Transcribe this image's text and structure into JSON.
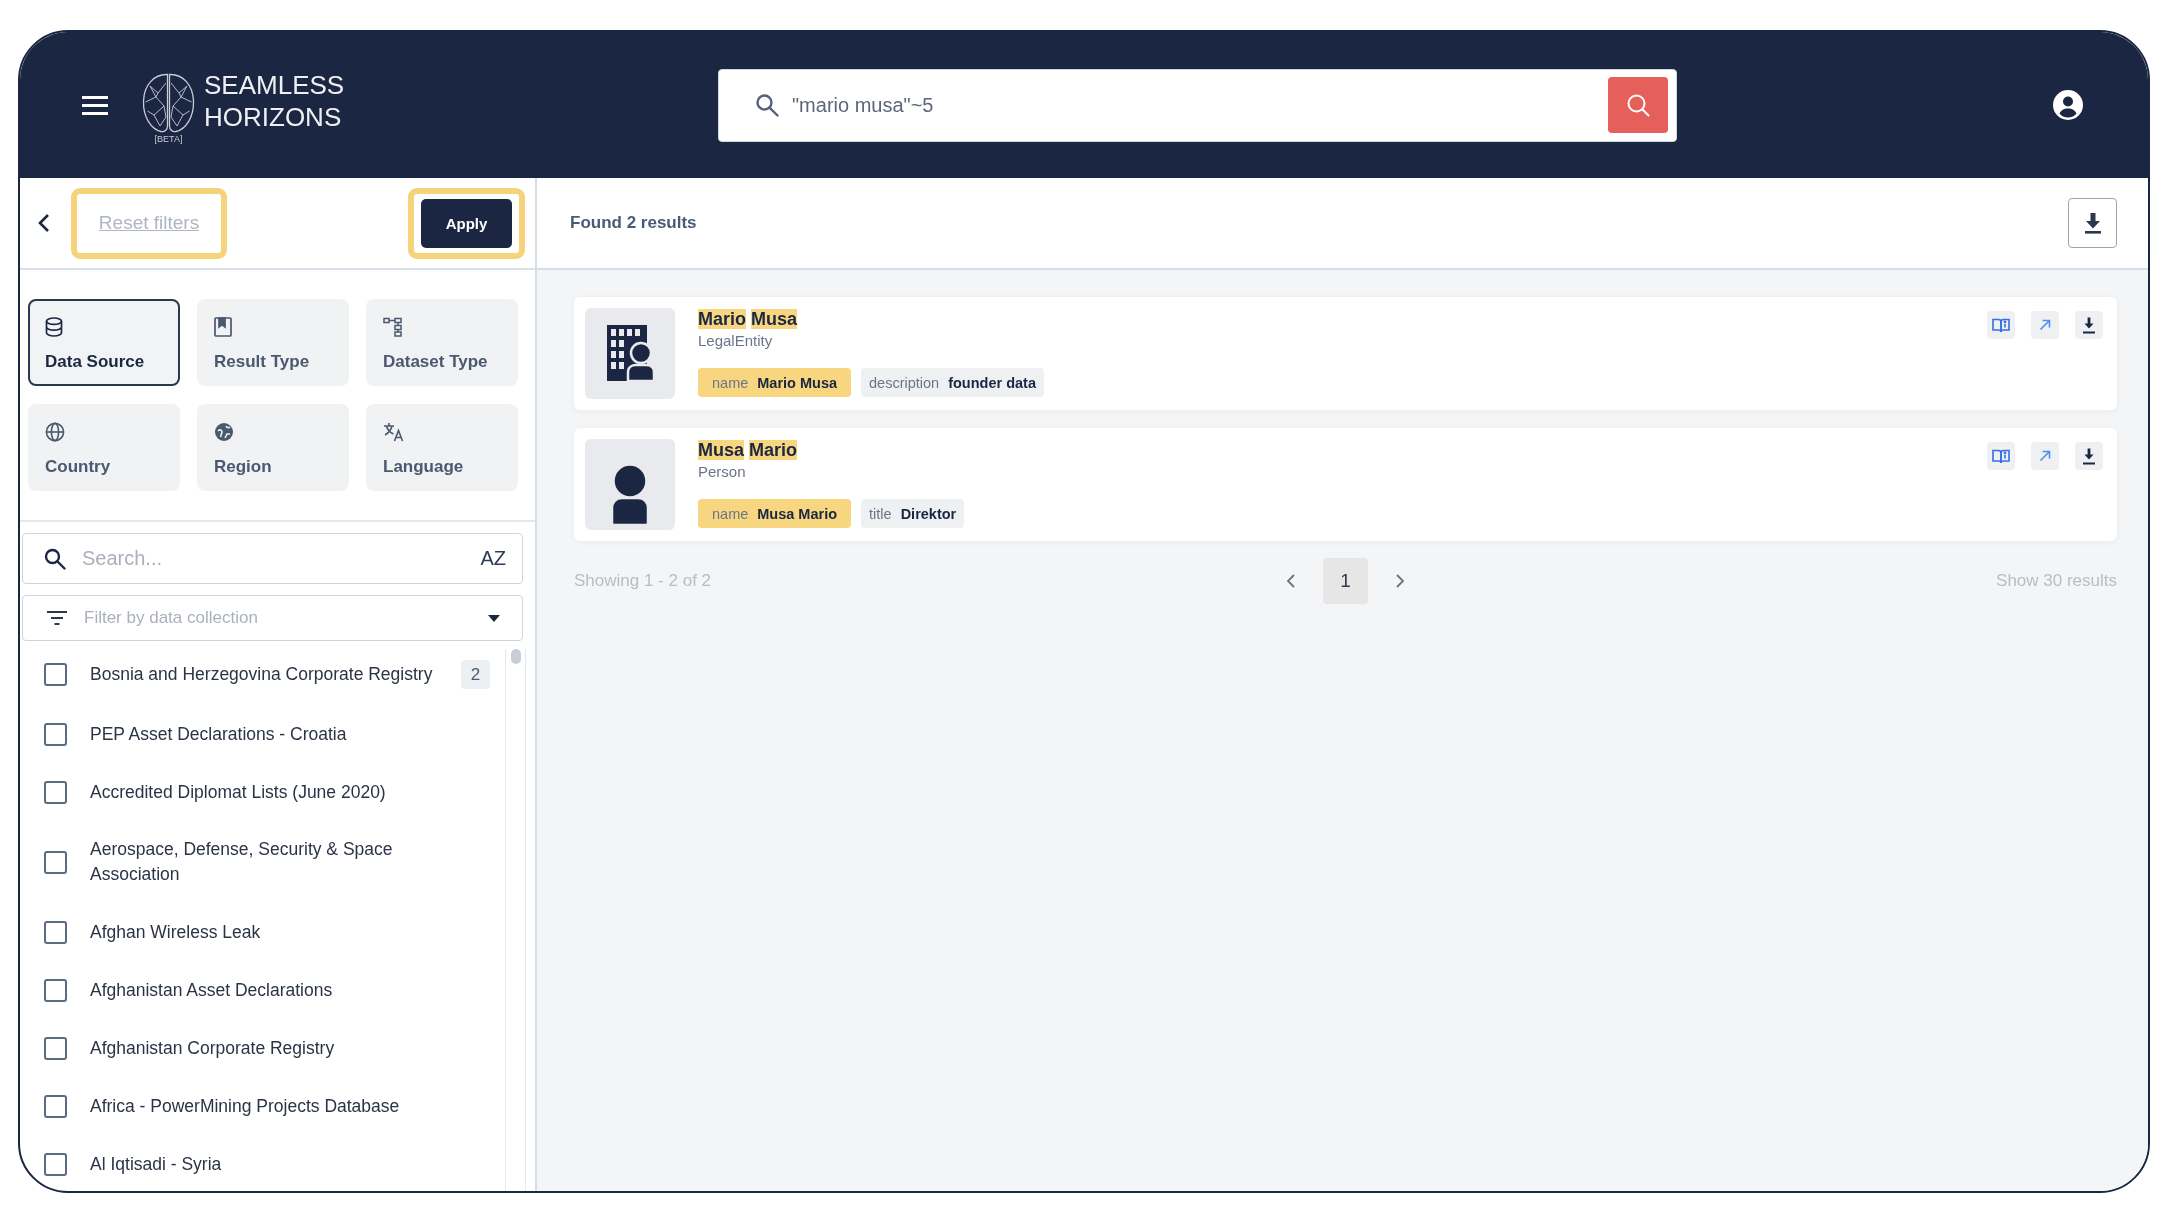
{
  "header": {
    "logo": {
      "lines": [
        "SEAMLESS",
        "HORIZONS"
      ],
      "badge": "[BETA]"
    },
    "search": {
      "value": "\"mario musa\"~5"
    }
  },
  "filter_panel": {
    "toolbar": {
      "reset": {
        "label": "Reset filters",
        "highlighted": true
      },
      "apply": {
        "label": "Apply",
        "highlighted": true
      }
    },
    "categories": [
      {
        "label": "Data Source",
        "selected": true
      },
      {
        "label": "Result Type",
        "selected": false
      },
      {
        "label": "Dataset Type",
        "selected": false
      },
      {
        "label": "Country",
        "selected": false
      },
      {
        "label": "Region",
        "selected": false
      },
      {
        "label": "Language",
        "selected": false
      }
    ],
    "search": {
      "placeholder": "Search...",
      "sort_label": "AZ"
    },
    "collection_filter": {
      "placeholder": "Filter by data collection"
    },
    "sources": [
      {
        "label": "Bosnia and Herzegovina Corporate Registry",
        "checked": false,
        "count": "2"
      },
      {
        "label": "PEP Asset Declarations - Croatia",
        "checked": false
      },
      {
        "label": "Accredited Diplomat Lists (June 2020)",
        "checked": false
      },
      {
        "label": "Aerospace, Defense, Security & Space Association",
        "checked": false
      },
      {
        "label": "Afghan Wireless Leak",
        "checked": false
      },
      {
        "label": "Afghanistan Asset Declarations",
        "checked": false
      },
      {
        "label": "Afghanistan Corporate Registry",
        "checked": false
      },
      {
        "label": "Africa - PowerMining Projects Database",
        "checked": false
      },
      {
        "label": "Al Iqtisadi - Syria",
        "checked": false
      }
    ]
  },
  "results": {
    "summary": "Found 2 results",
    "items": [
      {
        "kind": "entity",
        "title": [
          {
            "text": "Mario",
            "highlighted": true
          },
          {
            "text": "Musa",
            "highlighted": true
          }
        ],
        "type": "LegalEntity",
        "fields": [
          {
            "key": "name",
            "value": "Mario Musa",
            "highlighted": true
          },
          {
            "key": "description",
            "value": "founder data",
            "highlighted": false
          }
        ]
      },
      {
        "kind": "person",
        "title": [
          {
            "text": "Musa",
            "highlighted": true
          },
          {
            "text": "Mario",
            "highlighted": true
          }
        ],
        "type": "Person",
        "fields": [
          {
            "key": "name",
            "value": "Musa Mario",
            "highlighted": true
          },
          {
            "key": "title",
            "value": "Direktor",
            "highlighted": false
          }
        ]
      }
    ],
    "pagination": {
      "showing": "Showing 1 - 2 of 2",
      "pages": [
        {
          "label": "1",
          "selected": true
        }
      ],
      "page_size": "Show 30 results"
    }
  }
}
